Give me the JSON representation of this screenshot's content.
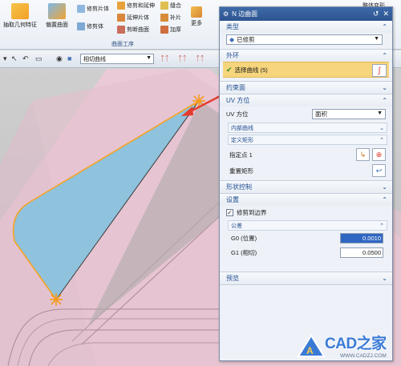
{
  "ribbon": {
    "extract_feature": "抽取几何特征",
    "offset_surface": "偏置曲面",
    "trim_sheet": "修剪片体",
    "sew": "修剪体",
    "trim_extend": "修剪和延伸",
    "extend_sheet": "延伸片体",
    "divide_face": "剪断曲面",
    "stitch": "缝合",
    "patch": "补片",
    "thicken": "加厚",
    "more": "更多",
    "overall_deform": "整体变形",
    "group_label": "曲面工序"
  },
  "toolbar": {
    "curve_rule": "相切曲线"
  },
  "dialog": {
    "title": "N 边曲面",
    "type": {
      "label": "类型",
      "value": "已修剪"
    },
    "outer_loop": {
      "label": "外环",
      "select_curve": "选择曲线 (5)"
    },
    "constraint_face": {
      "label": "约束面"
    },
    "uv_orientation": {
      "label": "UV 方位",
      "uv_label": "UV 方位",
      "uv_value": "面积",
      "inner_curve": "内部曲线",
      "define_rect": "定义矩形",
      "specify_point": "指定点 1",
      "reset_rect": "重置矩形"
    },
    "shape_control": {
      "label": "形状控制"
    },
    "settings": {
      "label": "设置",
      "trim_to_boundary": "修剪到边界",
      "trim_checked": true,
      "tolerance": {
        "label": "公差",
        "g0_label": "G0 (位置)",
        "g0_value": "0.0010",
        "g1_label": "G1 (相切)",
        "g1_value": "0.0500"
      }
    },
    "preview": {
      "label": "预览"
    }
  },
  "watermark": {
    "brand": "CAD之家",
    "url": "WWW.CADZJ.COM"
  },
  "colors": {
    "accent": "#2c5490",
    "section_text": "#1d4c8f",
    "highlight_row": "#f6d57c",
    "surface_fill": "#8fc2dc",
    "boundary_curve": "#f5a324"
  }
}
